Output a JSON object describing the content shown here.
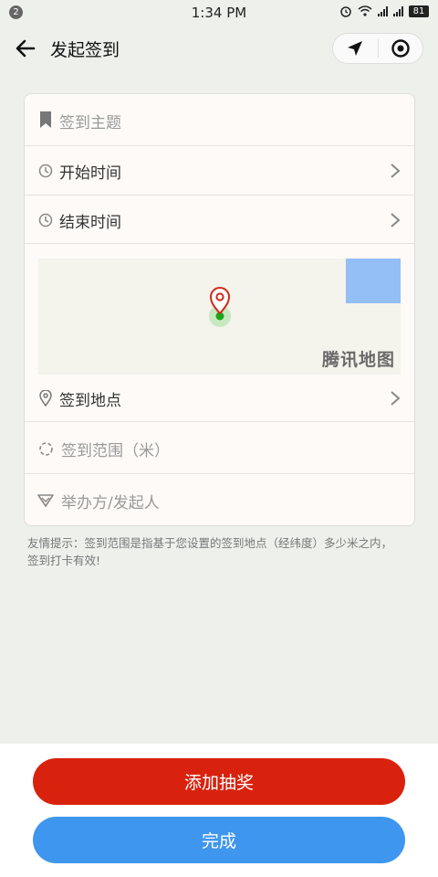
{
  "status": {
    "notifications": "2",
    "time": "1:34 PM",
    "battery": "81"
  },
  "header": {
    "title": "发起签到"
  },
  "form": {
    "topic": "签到主题",
    "start_time": "开始时间",
    "end_time": "结束时间",
    "map_brand": "腾讯地图",
    "location": "签到地点",
    "range": "签到范围（米）",
    "organizer": "举办方/发起人"
  },
  "tips": "友情提示：签到范围是指基于您设置的签到地点（经纬度）多少米之内，签到打卡有效!",
  "buttons": {
    "add_lottery": "添加抽奖",
    "finish": "完成"
  },
  "colors": {
    "primary_red": "#d9220e",
    "primary_blue": "#3f96ee"
  }
}
